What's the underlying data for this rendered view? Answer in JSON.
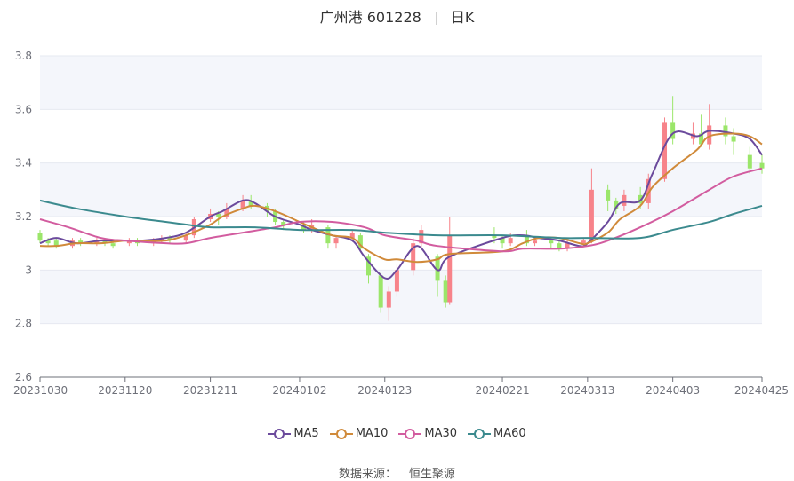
{
  "header": {
    "stock_name": "广州港 601228",
    "period": "日K"
  },
  "source": {
    "label": "数据来源：",
    "provider": "恒生聚源"
  },
  "colors": {
    "up": "#f7838a",
    "down": "#9be66a",
    "ma5": "#6b4a9c",
    "ma10": "#d08a3a",
    "ma30": "#d25c9f",
    "ma60": "#3b8a8e",
    "grid": "#e6e9f0",
    "band": "#f4f6fb",
    "axis": "#6e7079"
  },
  "chart_data": {
    "type": "candlestick",
    "title": "广州港 601228",
    "subtitle": "日K",
    "ylim": [
      2.6,
      3.8
    ],
    "yticks": [
      "2.6",
      "2.8",
      "3",
      "3.2",
      "3.4",
      "3.6",
      "3.8"
    ],
    "xlim": [
      "2023-10-30",
      "2024-04-25"
    ],
    "xticks": [
      "20231030",
      "20231120",
      "20231211",
      "20240102",
      "20240123",
      "20240221",
      "20240313",
      "20240403",
      "20240425"
    ],
    "legend": [
      {
        "name": "MA5",
        "color_key": "ma5"
      },
      {
        "name": "MA10",
        "color_key": "ma10"
      },
      {
        "name": "MA30",
        "color_key": "ma30"
      },
      {
        "name": "MA60",
        "color_key": "ma60"
      }
    ],
    "ma_series": [
      {
        "name": "MA5",
        "color_key": "ma5",
        "points": [
          [
            "2023-10-30",
            3.1
          ],
          [
            "2023-11-03",
            3.12
          ],
          [
            "2023-11-08",
            3.1
          ],
          [
            "2023-11-14",
            3.11
          ],
          [
            "2023-11-20",
            3.11
          ],
          [
            "2023-11-24",
            3.11
          ],
          [
            "2023-11-30",
            3.12
          ],
          [
            "2023-12-05",
            3.14
          ],
          [
            "2023-12-11",
            3.2
          ],
          [
            "2023-12-14",
            3.22
          ],
          [
            "2023-12-19",
            3.26
          ],
          [
            "2023-12-22",
            3.25
          ],
          [
            "2023-12-27",
            3.2
          ],
          [
            "2024-01-02",
            3.17
          ],
          [
            "2024-01-05",
            3.15
          ],
          [
            "2024-01-10",
            3.13
          ],
          [
            "2024-01-15",
            3.11
          ],
          [
            "2024-01-18",
            3.05
          ],
          [
            "2024-01-23",
            2.97
          ],
          [
            "2024-01-26",
            3.0
          ],
          [
            "2024-01-31",
            3.09
          ],
          [
            "2024-02-05",
            3.0
          ],
          [
            "2024-02-08",
            3.05
          ],
          [
            "2024-02-21",
            3.12
          ],
          [
            "2024-02-26",
            3.13
          ],
          [
            "2024-03-01",
            3.12
          ],
          [
            "2024-03-06",
            3.11
          ],
          [
            "2024-03-11",
            3.09
          ],
          [
            "2024-03-13",
            3.1
          ],
          [
            "2024-03-18",
            3.18
          ],
          [
            "2024-03-21",
            3.25
          ],
          [
            "2024-03-26",
            3.26
          ],
          [
            "2024-03-29",
            3.36
          ],
          [
            "2024-04-03",
            3.51
          ],
          [
            "2024-04-09",
            3.5
          ],
          [
            "2024-04-12",
            3.52
          ],
          [
            "2024-04-18",
            3.51
          ],
          [
            "2024-04-22",
            3.49
          ],
          [
            "2024-04-25",
            3.43
          ]
        ]
      },
      {
        "name": "MA10",
        "color_key": "ma10",
        "points": [
          [
            "2023-10-30",
            3.09
          ],
          [
            "2023-11-03",
            3.09
          ],
          [
            "2023-11-08",
            3.1
          ],
          [
            "2023-11-14",
            3.1
          ],
          [
            "2023-11-20",
            3.11
          ],
          [
            "2023-11-24",
            3.11
          ],
          [
            "2023-11-30",
            3.11
          ],
          [
            "2023-12-05",
            3.13
          ],
          [
            "2023-12-11",
            3.17
          ],
          [
            "2023-12-14",
            3.2
          ],
          [
            "2023-12-19",
            3.23
          ],
          [
            "2023-12-22",
            3.24
          ],
          [
            "2023-12-27",
            3.22
          ],
          [
            "2024-01-02",
            3.18
          ],
          [
            "2024-01-05",
            3.16
          ],
          [
            "2024-01-10",
            3.13
          ],
          [
            "2024-01-15",
            3.12
          ],
          [
            "2024-01-18",
            3.08
          ],
          [
            "2024-01-23",
            3.04
          ],
          [
            "2024-01-26",
            3.04
          ],
          [
            "2024-01-31",
            3.03
          ],
          [
            "2024-02-05",
            3.04
          ],
          [
            "2024-02-08",
            3.06
          ],
          [
            "2024-02-21",
            3.07
          ],
          [
            "2024-02-26",
            3.1
          ],
          [
            "2024-03-01",
            3.12
          ],
          [
            "2024-03-06",
            3.12
          ],
          [
            "2024-03-11",
            3.1
          ],
          [
            "2024-03-13",
            3.1
          ],
          [
            "2024-03-18",
            3.14
          ],
          [
            "2024-03-21",
            3.19
          ],
          [
            "2024-03-26",
            3.24
          ],
          [
            "2024-03-29",
            3.31
          ],
          [
            "2024-04-03",
            3.38
          ],
          [
            "2024-04-09",
            3.45
          ],
          [
            "2024-04-12",
            3.5
          ],
          [
            "2024-04-18",
            3.51
          ],
          [
            "2024-04-22",
            3.5
          ],
          [
            "2024-04-25",
            3.47
          ]
        ]
      },
      {
        "name": "MA30",
        "color_key": "ma30",
        "points": [
          [
            "2023-10-30",
            3.19
          ],
          [
            "2023-11-06",
            3.16
          ],
          [
            "2023-11-14",
            3.12
          ],
          [
            "2023-11-20",
            3.11
          ],
          [
            "2023-11-30",
            3.1
          ],
          [
            "2023-12-05",
            3.1
          ],
          [
            "2023-12-11",
            3.12
          ],
          [
            "2023-12-19",
            3.14
          ],
          [
            "2023-12-27",
            3.16
          ],
          [
            "2024-01-02",
            3.18
          ],
          [
            "2024-01-10",
            3.18
          ],
          [
            "2024-01-18",
            3.16
          ],
          [
            "2024-01-23",
            3.13
          ],
          [
            "2024-01-31",
            3.11
          ],
          [
            "2024-02-05",
            3.09
          ],
          [
            "2024-02-21",
            3.07
          ],
          [
            "2024-02-26",
            3.08
          ],
          [
            "2024-03-06",
            3.08
          ],
          [
            "2024-03-13",
            3.09
          ],
          [
            "2024-03-18",
            3.11
          ],
          [
            "2024-03-26",
            3.16
          ],
          [
            "2024-04-03",
            3.22
          ],
          [
            "2024-04-12",
            3.3
          ],
          [
            "2024-04-18",
            3.35
          ],
          [
            "2024-04-25",
            3.38
          ]
        ]
      },
      {
        "name": "MA60",
        "color_key": "ma60",
        "points": [
          [
            "2023-10-30",
            3.26
          ],
          [
            "2023-11-08",
            3.23
          ],
          [
            "2023-11-20",
            3.2
          ],
          [
            "2023-11-30",
            3.18
          ],
          [
            "2023-12-05",
            3.17
          ],
          [
            "2023-12-11",
            3.16
          ],
          [
            "2023-12-22",
            3.16
          ],
          [
            "2024-01-02",
            3.15
          ],
          [
            "2024-01-15",
            3.15
          ],
          [
            "2024-01-23",
            3.14
          ],
          [
            "2024-02-05",
            3.13
          ],
          [
            "2024-02-21",
            3.13
          ],
          [
            "2024-03-06",
            3.12
          ],
          [
            "2024-03-13",
            3.12
          ],
          [
            "2024-03-26",
            3.12
          ],
          [
            "2024-04-03",
            3.15
          ],
          [
            "2024-04-12",
            3.18
          ],
          [
            "2024-04-18",
            3.21
          ],
          [
            "2024-04-25",
            3.24
          ]
        ]
      }
    ],
    "candles": [
      [
        "2023-10-30",
        3.14,
        3.11,
        3.15,
        3.1
      ],
      [
        "2023-11-01",
        3.11,
        3.1,
        3.12,
        3.09
      ],
      [
        "2023-11-03",
        3.11,
        3.09,
        3.12,
        3.08
      ],
      [
        "2023-11-07",
        3.09,
        3.11,
        3.12,
        3.08
      ],
      [
        "2023-11-09",
        3.11,
        3.1,
        3.12,
        3.09
      ],
      [
        "2023-11-13",
        3.1,
        3.11,
        3.12,
        3.09
      ],
      [
        "2023-11-15",
        3.11,
        3.1,
        3.12,
        3.09
      ],
      [
        "2023-11-17",
        3.1,
        3.09,
        3.11,
        3.08
      ],
      [
        "2023-11-21",
        3.1,
        3.11,
        3.12,
        3.09
      ],
      [
        "2023-11-23",
        3.11,
        3.1,
        3.12,
        3.09
      ],
      [
        "2023-11-27",
        3.1,
        3.11,
        3.12,
        3.09
      ],
      [
        "2023-11-29",
        3.11,
        3.12,
        3.13,
        3.1
      ],
      [
        "2023-12-01",
        3.12,
        3.11,
        3.13,
        3.1
      ],
      [
        "2023-12-05",
        3.11,
        3.13,
        3.14,
        3.1
      ],
      [
        "2023-12-07",
        3.13,
        3.19,
        3.2,
        3.12
      ],
      [
        "2023-12-11",
        3.19,
        3.21,
        3.23,
        3.18
      ],
      [
        "2023-12-13",
        3.21,
        3.2,
        3.22,
        3.17
      ],
      [
        "2023-12-15",
        3.2,
        3.23,
        3.25,
        3.19
      ],
      [
        "2023-12-19",
        3.23,
        3.26,
        3.28,
        3.22
      ],
      [
        "2023-12-21",
        3.26,
        3.24,
        3.28,
        3.23
      ],
      [
        "2023-12-25",
        3.24,
        3.22,
        3.25,
        3.2
      ],
      [
        "2023-12-27",
        3.22,
        3.18,
        3.23,
        3.17
      ],
      [
        "2023-12-29",
        3.18,
        3.17,
        3.19,
        3.15
      ],
      [
        "2024-01-03",
        3.17,
        3.15,
        3.18,
        3.14
      ],
      [
        "2024-01-05",
        3.15,
        3.17,
        3.19,
        3.14
      ],
      [
        "2024-01-09",
        3.16,
        3.1,
        3.17,
        3.08
      ],
      [
        "2024-01-11",
        3.1,
        3.12,
        3.13,
        3.08
      ],
      [
        "2024-01-15",
        3.12,
        3.14,
        3.15,
        3.11
      ],
      [
        "2024-01-17",
        3.13,
        3.08,
        3.14,
        3.07
      ],
      [
        "2024-01-19",
        3.05,
        2.98,
        3.06,
        2.95
      ],
      [
        "2024-01-22",
        2.98,
        2.86,
        2.99,
        2.84
      ],
      [
        "2024-01-24",
        2.86,
        2.92,
        2.94,
        2.81
      ],
      [
        "2024-01-26",
        2.92,
        3.0,
        3.02,
        2.9
      ],
      [
        "2024-01-30",
        3.0,
        3.1,
        3.12,
        2.98
      ],
      [
        "2024-02-01",
        3.1,
        3.15,
        3.17,
        3.08
      ],
      [
        "2024-02-05",
        3.05,
        2.96,
        3.06,
        2.9
      ],
      [
        "2024-02-07",
        2.96,
        2.88,
        2.98,
        2.86
      ],
      [
        "2024-02-08",
        2.88,
        3.13,
        3.2,
        2.87
      ],
      [
        "2024-02-19",
        3.13,
        3.12,
        3.16,
        3.1
      ],
      [
        "2024-02-21",
        3.12,
        3.1,
        3.13,
        3.08
      ],
      [
        "2024-02-23",
        3.1,
        3.12,
        3.14,
        3.09
      ],
      [
        "2024-02-27",
        3.13,
        3.1,
        3.15,
        3.09
      ],
      [
        "2024-02-29",
        3.1,
        3.11,
        3.12,
        3.09
      ],
      [
        "2024-03-04",
        3.11,
        3.1,
        3.12,
        3.08
      ],
      [
        "2024-03-06",
        3.1,
        3.08,
        3.11,
        3.07
      ],
      [
        "2024-03-08",
        3.08,
        3.1,
        3.11,
        3.07
      ],
      [
        "2024-03-12",
        3.1,
        3.11,
        3.12,
        3.09
      ],
      [
        "2024-03-14",
        3.11,
        3.3,
        3.38,
        3.1
      ],
      [
        "2024-03-18",
        3.3,
        3.26,
        3.32,
        3.22
      ],
      [
        "2024-03-20",
        3.26,
        3.23,
        3.27,
        3.21
      ],
      [
        "2024-03-22",
        3.24,
        3.28,
        3.3,
        3.22
      ],
      [
        "2024-03-26",
        3.28,
        3.25,
        3.31,
        3.23
      ],
      [
        "2024-03-28",
        3.25,
        3.34,
        3.36,
        3.23
      ],
      [
        "2024-04-01",
        3.34,
        3.55,
        3.57,
        3.33
      ],
      [
        "2024-04-03",
        3.55,
        3.49,
        3.65,
        3.47
      ],
      [
        "2024-04-08",
        3.49,
        3.51,
        3.55,
        3.47
      ],
      [
        "2024-04-10",
        3.51,
        3.47,
        3.58,
        3.46
      ],
      [
        "2024-04-12",
        3.47,
        3.54,
        3.62,
        3.45
      ],
      [
        "2024-04-16",
        3.54,
        3.5,
        3.57,
        3.47
      ],
      [
        "2024-04-18",
        3.5,
        3.48,
        3.53,
        3.43
      ],
      [
        "2024-04-22",
        3.43,
        3.38,
        3.46,
        3.36
      ],
      [
        "2024-04-25",
        3.4,
        3.38,
        3.43,
        3.36
      ]
    ]
  }
}
